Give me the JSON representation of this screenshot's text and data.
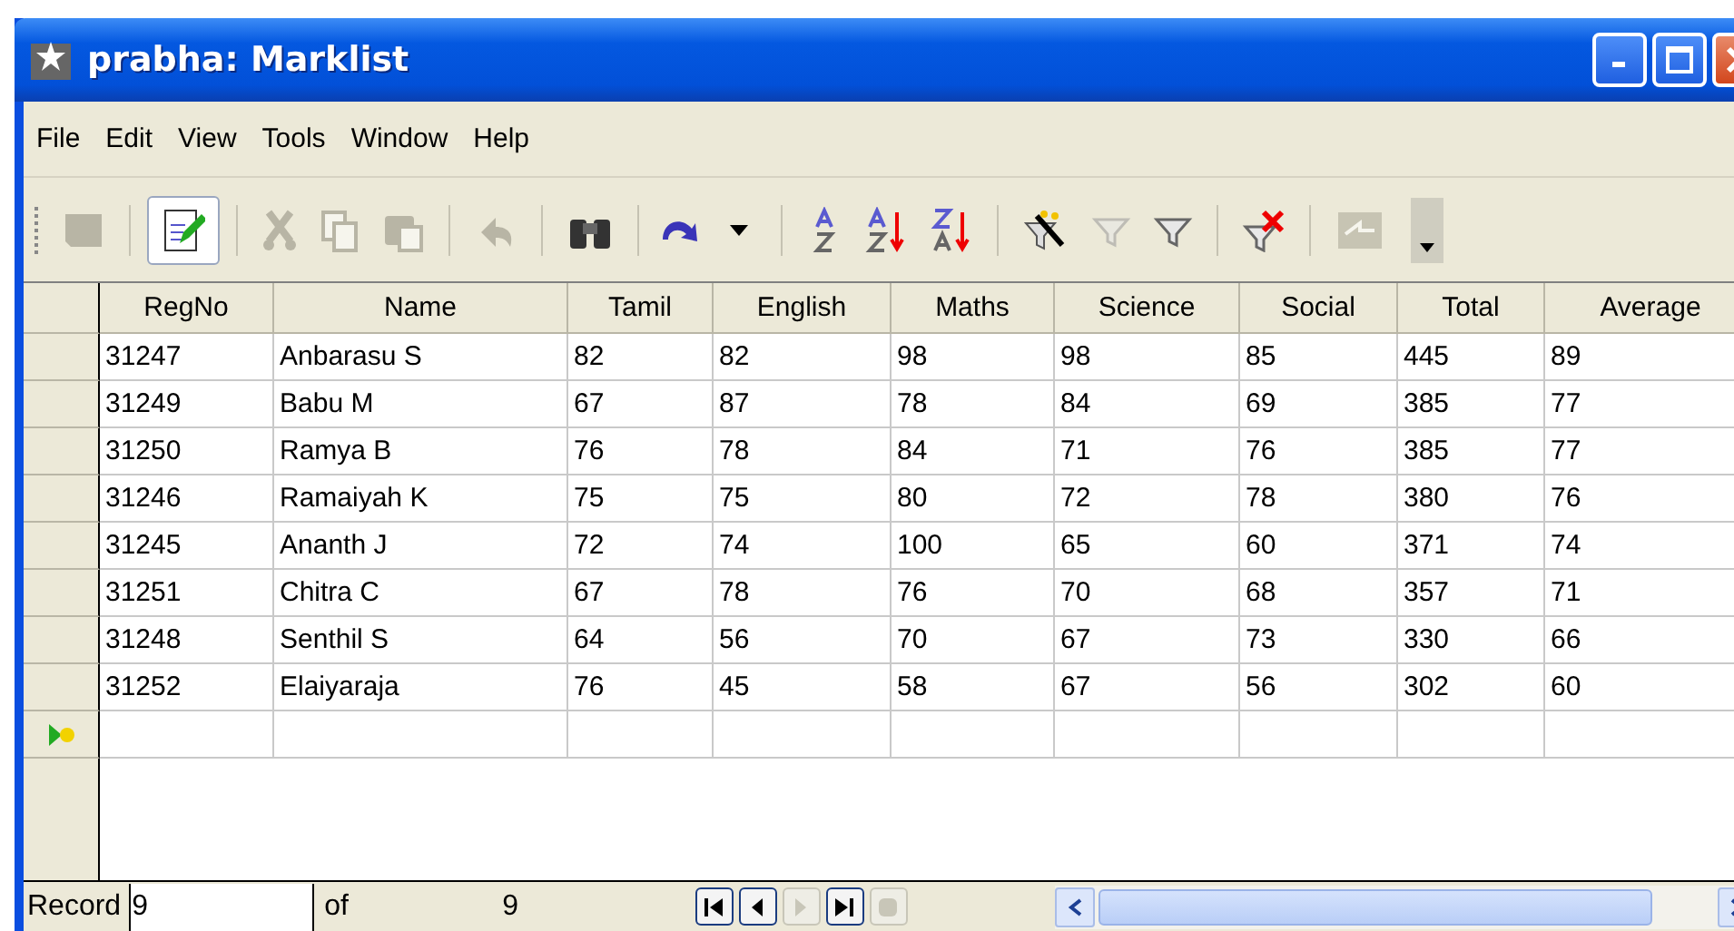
{
  "window": {
    "title": "prabha: Marklist"
  },
  "menu": [
    "File",
    "Edit",
    "View",
    "Tools",
    "Window",
    "Help"
  ],
  "toolbar": [
    [
      {
        "kind": "save",
        "disabled": true,
        "selected": false
      }
    ],
    [
      {
        "kind": "edit",
        "disabled": false,
        "selected": true
      }
    ],
    [
      {
        "kind": "cut",
        "disabled": true,
        "selected": false
      },
      {
        "kind": "copy",
        "disabled": true,
        "selected": false
      },
      {
        "kind": "paste",
        "disabled": true,
        "selected": false
      }
    ],
    [
      {
        "kind": "undo",
        "disabled": true,
        "selected": false
      }
    ],
    [
      {
        "kind": "find",
        "disabled": false,
        "selected": false
      }
    ],
    [
      {
        "kind": "refresh",
        "disabled": false,
        "selected": false
      },
      {
        "kind": "dropdown",
        "disabled": false,
        "selected": false
      }
    ],
    [
      {
        "kind": "sort",
        "disabled": false,
        "selected": false
      },
      {
        "kind": "sortasc",
        "disabled": false,
        "selected": false
      },
      {
        "kind": "sortdesc",
        "disabled": false,
        "selected": false
      }
    ],
    [
      {
        "kind": "autofilter",
        "disabled": false,
        "selected": false
      },
      {
        "kind": "filter",
        "disabled": true,
        "selected": false
      },
      {
        "kind": "filter",
        "disabled": false,
        "selected": false
      }
    ],
    [
      {
        "kind": "removefilter",
        "disabled": false,
        "selected": false
      }
    ],
    [
      {
        "kind": "datasource",
        "disabled": true,
        "selected": false
      }
    ]
  ],
  "table": {
    "columns": [
      "RegNo",
      "Name",
      "Tamil",
      "English",
      "Maths",
      "Science",
      "Social",
      "Total",
      "Average"
    ],
    "rows": [
      {
        "cells": [
          "31247",
          "Anbarasu S",
          "82",
          "82",
          "98",
          "98",
          "85",
          "445",
          "89"
        ]
      },
      {
        "cells": [
          "31249",
          "Babu M",
          "67",
          "87",
          "78",
          "84",
          "69",
          "385",
          "77"
        ]
      },
      {
        "cells": [
          "31250",
          "Ramya B",
          "76",
          "78",
          "84",
          "71",
          "76",
          "385",
          "77"
        ]
      },
      {
        "cells": [
          "31246",
          "Ramaiyah K",
          "75",
          "75",
          "80",
          "72",
          "78",
          "380",
          "76"
        ]
      },
      {
        "cells": [
          "31245",
          "Ananth J",
          "72",
          "74",
          "100",
          "65",
          "60",
          "371",
          "74"
        ]
      },
      {
        "cells": [
          "31251",
          "Chitra C",
          "67",
          "78",
          "76",
          "70",
          "68",
          "357",
          "71"
        ]
      },
      {
        "cells": [
          "31248",
          "Senthil S",
          "64",
          "56",
          "70",
          "67",
          "73",
          "330",
          "66"
        ]
      },
      {
        "cells": [
          "31252",
          "Elaiyaraja",
          "76",
          "45",
          "58",
          "67",
          "56",
          "302",
          "60"
        ]
      }
    ],
    "new_row": {
      "current": true
    }
  },
  "record_bar": {
    "label": "Record",
    "value": "9",
    "of_label": "of",
    "total": "9",
    "nav": [
      {
        "kind": "first",
        "disabled": false
      },
      {
        "kind": "prev",
        "disabled": false
      },
      {
        "kind": "next",
        "disabled": true
      },
      {
        "kind": "last",
        "disabled": false
      },
      {
        "kind": "new",
        "disabled": true
      }
    ]
  }
}
